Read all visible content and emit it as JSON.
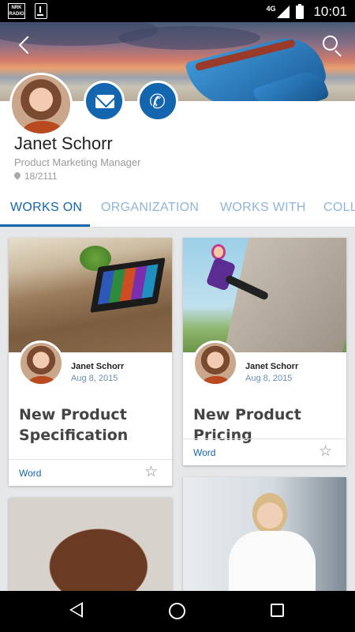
{
  "status_bar": {
    "left_icons": [
      "nrk-radio-icon",
      "download-icon"
    ],
    "nrk_label": "NRK RADIO",
    "network": "4G",
    "time": "10:01"
  },
  "header": {
    "back_icon": "back-arrow-icon",
    "search_icon": "search-icon"
  },
  "profile": {
    "name": "Janet Schorr",
    "job_title": "Product Marketing Manager",
    "office": "18/2111",
    "actions": {
      "mail_icon": "mail-icon",
      "call_icon": "phone-icon"
    }
  },
  "tabs": [
    {
      "label": "WORKS ON",
      "active": true
    },
    {
      "label": "ORGANIZATION",
      "active": false
    },
    {
      "label": "WORKS WITH",
      "active": false
    },
    {
      "label": "COLL",
      "active": false
    }
  ],
  "cards": [
    {
      "author": "Janet Schorr",
      "date": "Aug 8, 2015",
      "title_line1": "New Product",
      "title_line2": "Specification",
      "type": "Word",
      "image": "desk-tablet-photo"
    },
    {
      "author": "Janet Schorr",
      "date": "Aug 8, 2015",
      "title_line1": "New Product Pricing",
      "type": "Word",
      "image": "climbing-wall-photo"
    },
    {
      "image": "meeting-table-photo"
    },
    {
      "image": "woman-at-desk-photo"
    }
  ],
  "colors": {
    "accent": "#1465b0",
    "tab_inactive": "#8fb6da",
    "date_text": "#6a8fb3"
  },
  "nav_bar": {
    "icons": [
      "back-triangle-icon",
      "home-circle-icon",
      "recents-square-icon"
    ]
  }
}
